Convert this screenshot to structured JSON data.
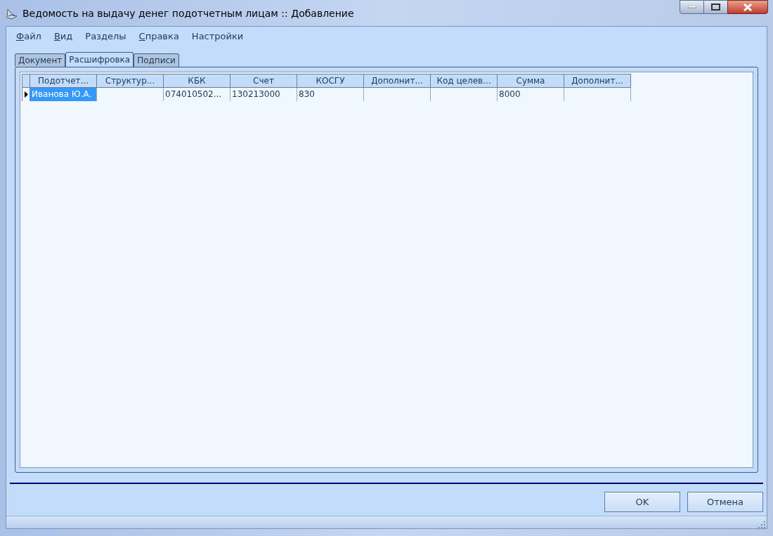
{
  "window": {
    "title": "Ведомость на выдачу денег подотчетным лицам :: Добавление"
  },
  "menu": [
    {
      "label": "Файл",
      "mnemonic": true
    },
    {
      "label": "Вид",
      "mnemonic": true
    },
    {
      "label": "Разделы",
      "mnemonic": false
    },
    {
      "label": "Справка",
      "mnemonic": true
    },
    {
      "label": "Настройки",
      "mnemonic": false
    }
  ],
  "tabs": [
    {
      "label": "Документ",
      "selected": false
    },
    {
      "label": "Расшифровка",
      "selected": true
    },
    {
      "label": "Подписи",
      "selected": false
    }
  ],
  "table": {
    "columns": [
      "Подотчет...",
      "Структур...",
      "КБК",
      "Счет",
      "КОСГУ",
      "Дополнит...",
      "Код целев...",
      "Сумма",
      "Дополнит..."
    ],
    "rows": [
      {
        "current": true,
        "cells": [
          {
            "text": "Иванова Ю.А.",
            "selected": true
          },
          {
            "selected": false
          },
          {
            "text": "074010502...",
            "selected": false
          },
          {
            "text": "130213000",
            "selected": false
          },
          {
            "text": "830",
            "selected": false
          },
          {
            "selected": false
          },
          {
            "selected": false
          },
          {
            "text": "8000",
            "selected": false
          },
          {
            "selected": false
          }
        ]
      }
    ]
  },
  "buttons": [
    "OK",
    "Отмена"
  ]
}
